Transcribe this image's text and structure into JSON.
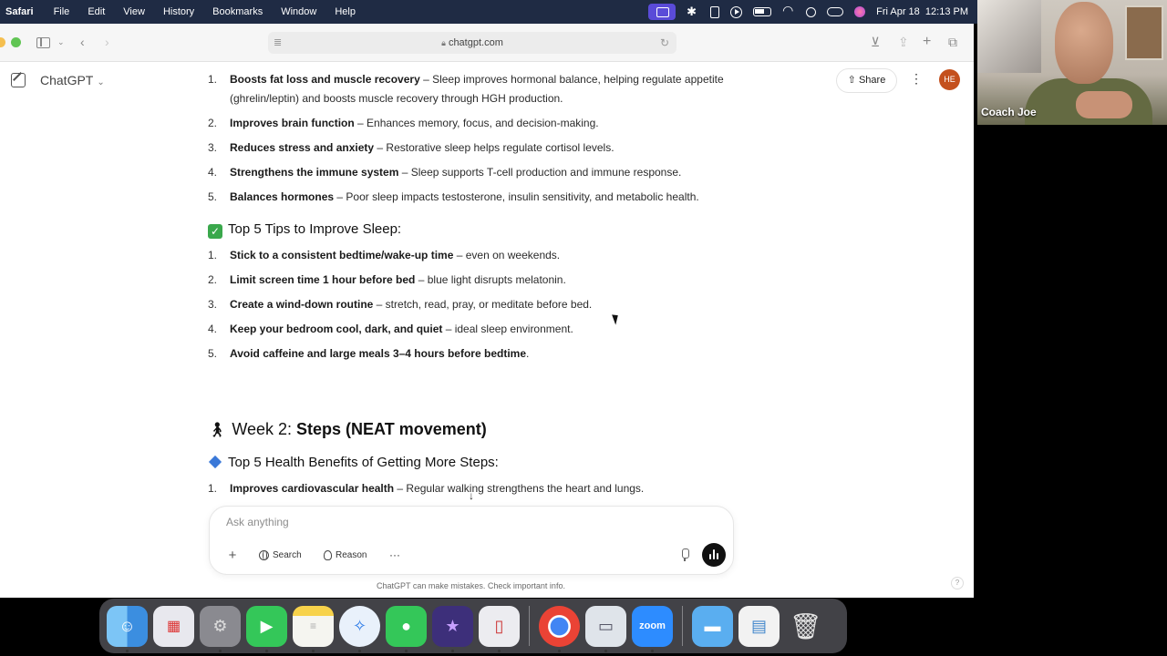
{
  "menubar": {
    "app_name": "Safari",
    "items": [
      "File",
      "Edit",
      "View",
      "History",
      "Bookmarks",
      "Window",
      "Help"
    ],
    "clock": "Fri Apr 18  12:13 PM"
  },
  "browser": {
    "url": "chatgpt.com"
  },
  "chatgpt": {
    "model_label": "ChatGPT",
    "share_label": "Share",
    "avatar_initials": "HE",
    "composer_placeholder": "Ask anything",
    "search_label": "Search",
    "reason_label": "Reason",
    "disclaimer": "ChatGPT can make mistakes. Check important info.",
    "help_label": "?"
  },
  "benefits": [
    {
      "num": "1.",
      "bold": "Boosts fat loss and muscle recovery",
      "rest": " – Sleep improves hormonal balance, helping regulate appetite (ghrelin/leptin) and boosts muscle recovery through HGH production."
    },
    {
      "num": "2.",
      "bold": "Improves brain function",
      "rest": " – Enhances memory, focus, and decision-making."
    },
    {
      "num": "3.",
      "bold": "Reduces stress and anxiety",
      "rest": " – Restorative sleep helps regulate cortisol levels."
    },
    {
      "num": "4.",
      "bold": "Strengthens the immune system",
      "rest": " – Sleep supports T-cell production and immune response."
    },
    {
      "num": "5.",
      "bold": "Balances hormones",
      "rest": " – Poor sleep impacts testosterone, insulin sensitivity, and metabolic health."
    }
  ],
  "tips_heading": "Top 5 Tips to Improve Sleep:",
  "tips": [
    {
      "num": "1.",
      "bold": "Stick to a consistent bedtime/wake-up time",
      "rest": " – even on weekends."
    },
    {
      "num": "2.",
      "bold": "Limit screen time 1 hour before bed",
      "rest": " – blue light disrupts melatonin."
    },
    {
      "num": "3.",
      "bold": "Create a wind-down routine",
      "rest": " – stretch, read, pray, or meditate before bed."
    },
    {
      "num": "4.",
      "bold": "Keep your bedroom cool, dark, and quiet",
      "rest": " – ideal sleep environment."
    },
    {
      "num": "5.",
      "bold": "Avoid caffeine and large meals 3–4 hours before bedtime",
      "rest": "."
    }
  ],
  "week2": {
    "prefix": "Week 2: ",
    "title": "Steps (NEAT movement)",
    "benefits_heading": "Top 5 Health Benefits of Getting More Steps:",
    "first_item": {
      "num": "1.",
      "bold": "Improves cardiovascular health",
      "rest": " – Regular walking strengthens the heart and lungs."
    }
  },
  "webcam": {
    "name": "Coach Joe"
  },
  "dock": {
    "zoom_label": "zoom"
  },
  "colors": {
    "menubar": "#1f2b44",
    "avatar": "#c4501d",
    "check": "#3aa84c",
    "diamond": "#3a78d8"
  }
}
